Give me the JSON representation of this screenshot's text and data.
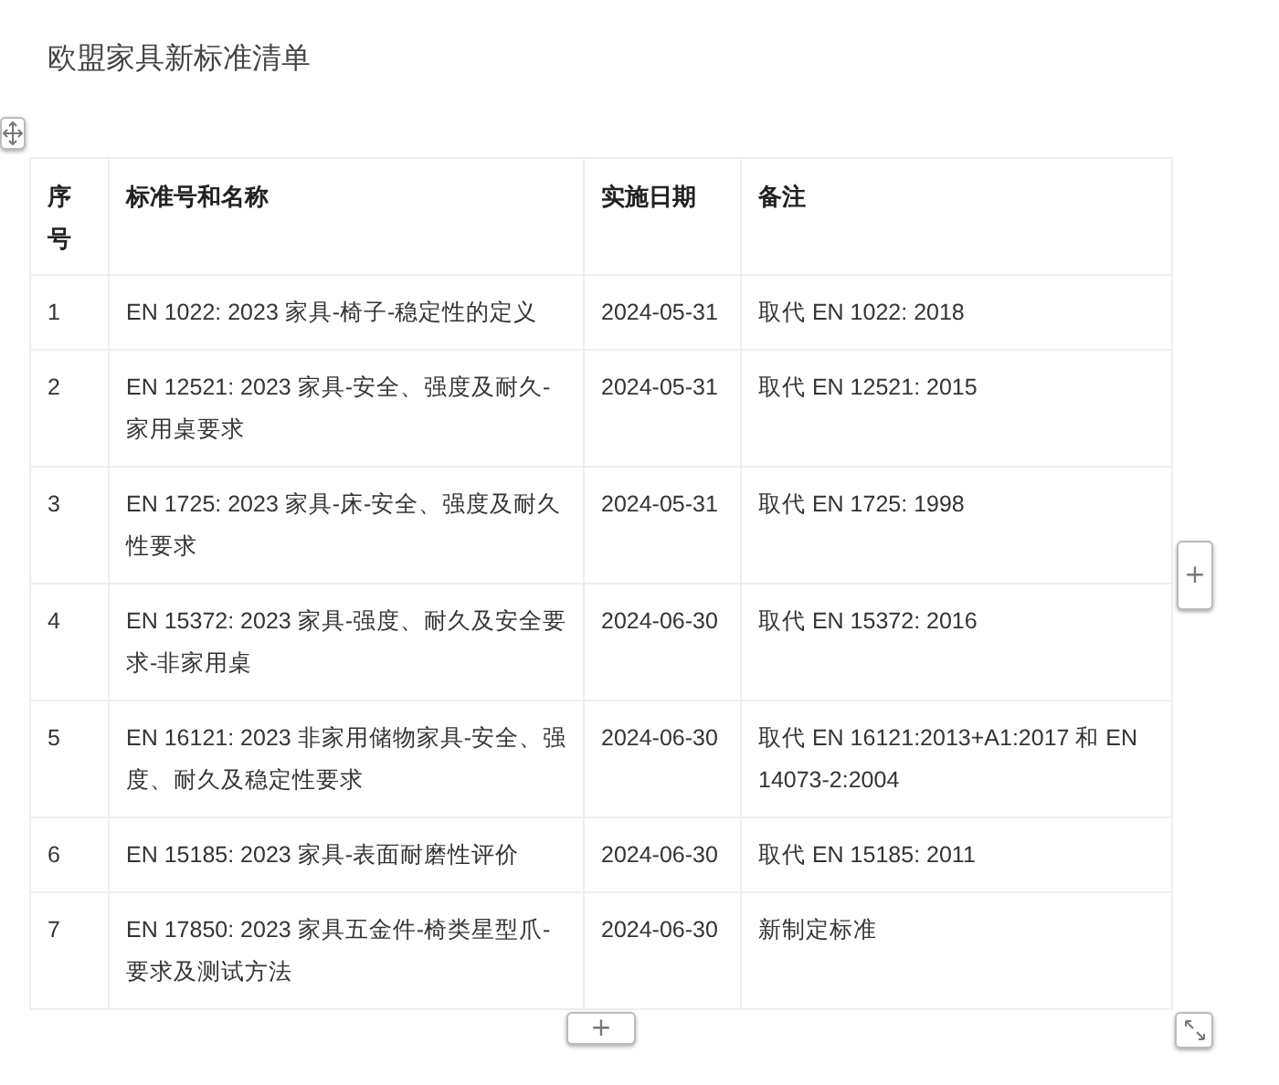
{
  "title": "欧盟家具新标准清单",
  "table": {
    "columns": [
      "序号",
      "标准号和名称",
      "实施日期",
      "备注"
    ],
    "rows": [
      [
        "1",
        "EN 1022: 2023  家具-椅子-稳定性的定义",
        "2024-05-31",
        "取代 EN 1022: 2018"
      ],
      [
        "2",
        "EN 12521: 2023  家具-安全、强度及耐久-家用桌要求",
        "2024-05-31",
        "取代 EN 12521: 2015"
      ],
      [
        "3",
        "EN 1725: 2023 家具-床-安全、强度及耐久性要求",
        "2024-05-31",
        "取代 EN 1725: 1998"
      ],
      [
        "4",
        "EN 15372: 2023  家具-强度、耐久及安全要求-非家用桌",
        "2024-06-30",
        "取代 EN 15372: 2016"
      ],
      [
        "5",
        "EN 16121: 2023 非家用储物家具-安全、强度、耐久及稳定性要求",
        "2024-06-30",
        "取代 EN 16121:2013+A1:2017 和 EN 14073-2:2004"
      ],
      [
        "6",
        "EN 15185: 2023 家具-表面耐磨性评价",
        "2024-06-30",
        "取代 EN 15185: 2011"
      ],
      [
        "7",
        "EN 17850: 2023 家具五金件-椅类星型爪-要求及测试方法",
        "2024-06-30",
        "新制定标准"
      ]
    ]
  },
  "add_column_button": "+",
  "add_row_button": "+"
}
